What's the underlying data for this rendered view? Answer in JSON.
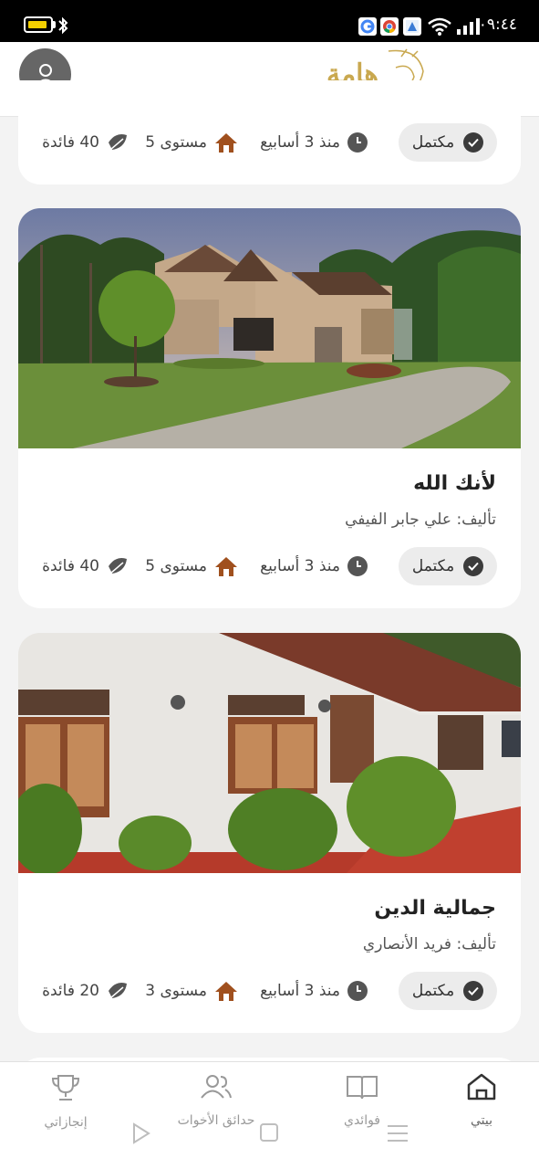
{
  "status_bar": {
    "time": "٠٩:٤٤",
    "battery_color": "#f4d000"
  },
  "header": {
    "logo_text": "هامة",
    "logo_color": "#c9a84f",
    "avatar_icon": "user-icon"
  },
  "cards": [
    {
      "title": "",
      "author": "",
      "status": "مكتمل",
      "time": "منذ 3 أسابيع",
      "level": "مستوى 5",
      "benefits": "40 فائدة"
    },
    {
      "title": "لأنك الله",
      "author": "تأليف: علي جابر الفيفي",
      "status": "مكتمل",
      "time": "منذ 3 أسابيع",
      "level": "مستوى 5",
      "benefits": "40 فائدة"
    },
    {
      "title": "جمالية الدين",
      "author": "تأليف: فريد الأنصاري",
      "status": "مكتمل",
      "time": "منذ 3 أسابيع",
      "level": "مستوى 3",
      "benefits": "20 فائدة"
    }
  ],
  "bottom_nav": {
    "home": "بيتي",
    "benefits": "فوائدي",
    "sisters": "حدائق الأخوات",
    "achievements": "إنجازاتي"
  },
  "colors": {
    "accent_gold": "#c9a84f",
    "level_icon": "#a0501e",
    "pill_bg": "#ececec"
  }
}
